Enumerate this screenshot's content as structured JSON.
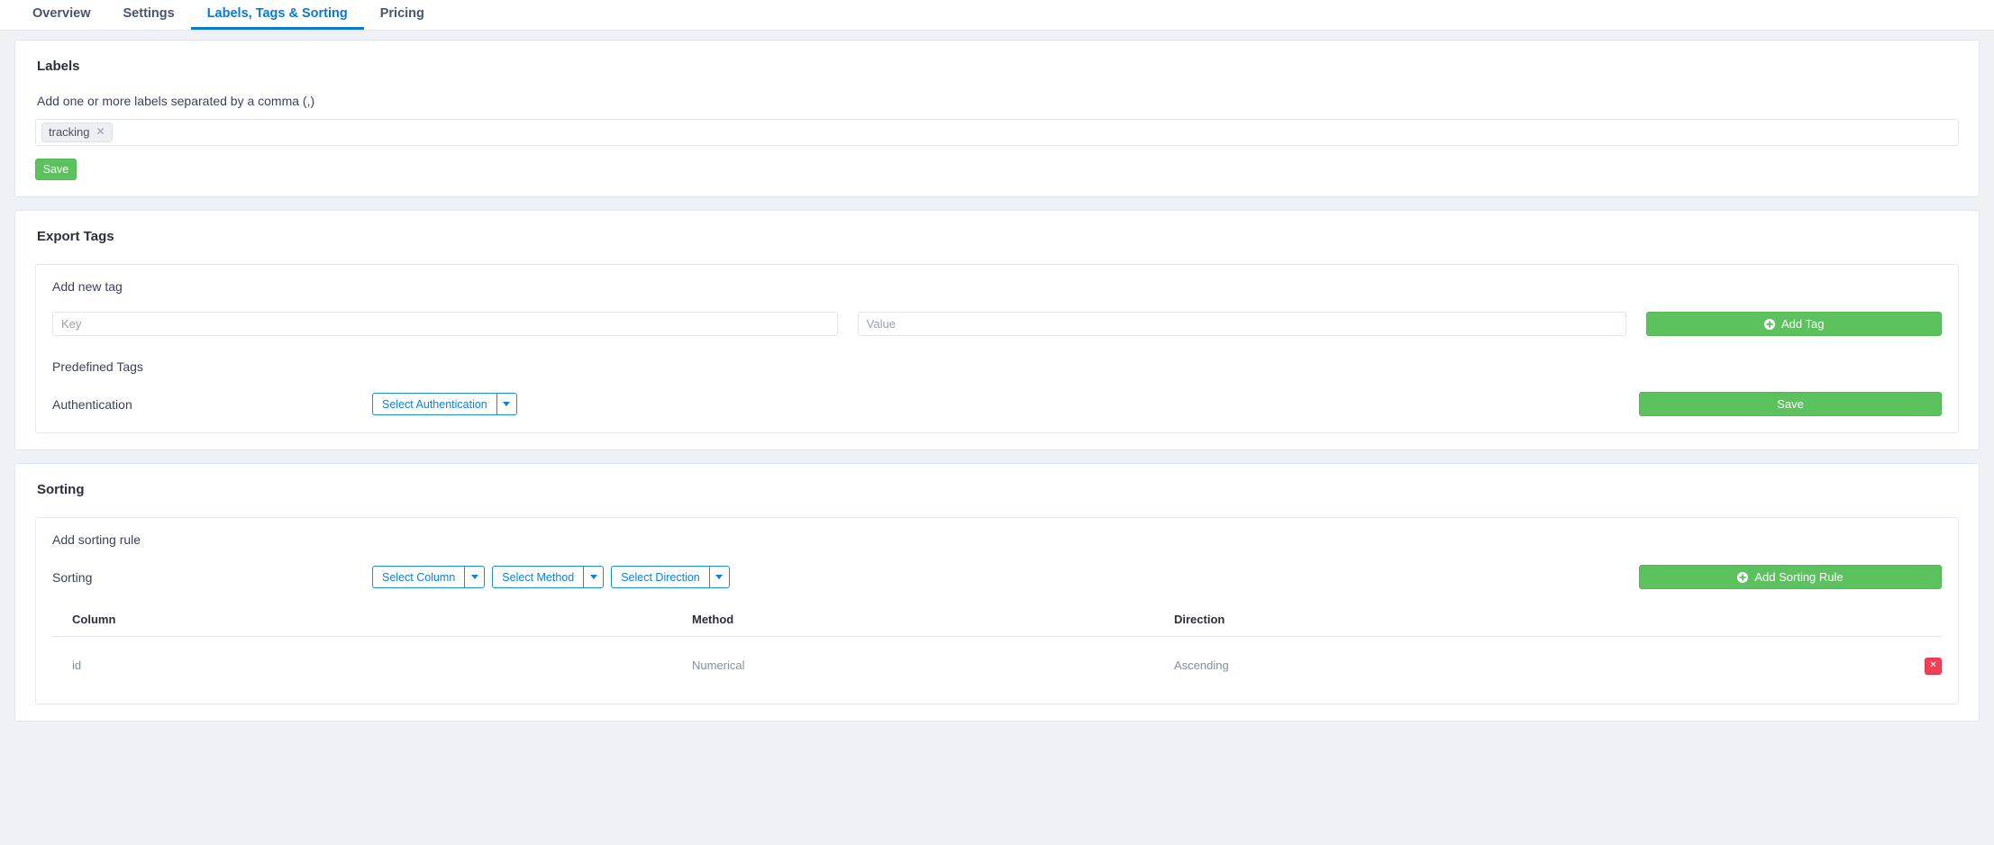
{
  "tabs": [
    {
      "label": "Overview",
      "active": false
    },
    {
      "label": "Settings",
      "active": false
    },
    {
      "label": "Labels, Tags & Sorting",
      "active": true
    },
    {
      "label": "Pricing",
      "active": false
    }
  ],
  "colors": {
    "accent_blue": "#0b79d0",
    "green": "#5bc25e",
    "red": "#ef4056",
    "page_bg": "#eef2f6",
    "card_bg": "#ffffff",
    "border": "#dfe6ee"
  },
  "labels_card": {
    "title": "Labels",
    "help": "Add one or more labels separated by a comma (,)",
    "chips": [
      {
        "text": "tracking",
        "remove_icon": "close-icon"
      }
    ],
    "save_label": "Save"
  },
  "export_tags_card": {
    "title": "Export Tags",
    "panel_label": "Add new tag",
    "key_placeholder": "Key",
    "key_value": "",
    "value_placeholder": "Value",
    "value_value": "",
    "add_tag_label": "Add Tag",
    "add_tag_icon": "plus-circle-icon",
    "predefined_heading": "Predefined Tags",
    "authentication_label": "Authentication",
    "authentication_select": "Select Authentication",
    "save_label": "Save"
  },
  "sorting_card": {
    "title": "Sorting",
    "panel_label": "Add sorting rule",
    "sorting_label": "Sorting",
    "select_column": "Select Column",
    "select_method": "Select Method",
    "select_direction": "Select Direction",
    "add_rule_label": "Add Sorting Rule",
    "add_rule_icon": "plus-circle-icon",
    "table": {
      "headers": [
        "Column",
        "Method",
        "Direction"
      ],
      "rows": [
        {
          "column": "id",
          "method": "Numerical",
          "direction": "Ascending",
          "delete_icon": "close-icon"
        }
      ]
    }
  }
}
